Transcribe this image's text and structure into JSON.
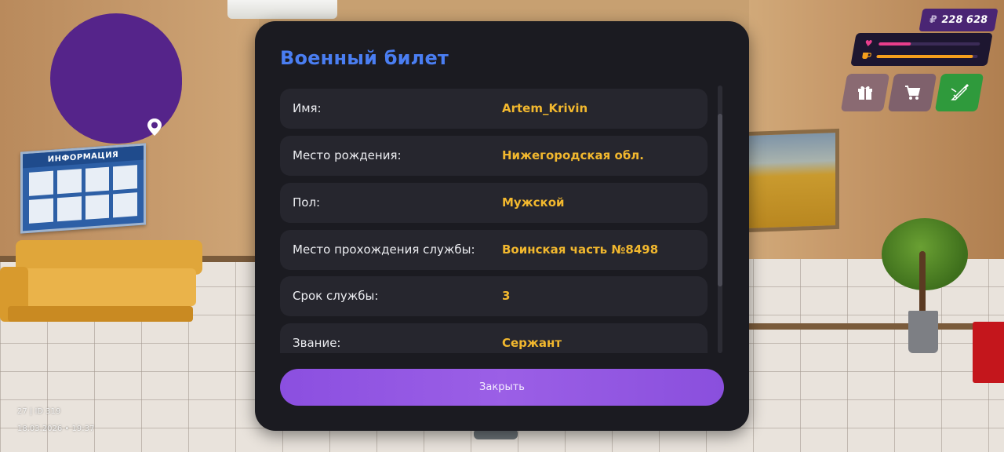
{
  "modal": {
    "title": "Военный билет",
    "rows": [
      {
        "label": "Имя:",
        "value": "Artem_Krivin"
      },
      {
        "label": "Место рождения:",
        "value": "Нижегородская обл."
      },
      {
        "label": "Пол:",
        "value": "Мужской"
      },
      {
        "label": "Место прохождения службы:",
        "value": "Воинская часть №8498"
      },
      {
        "label": "Срок службы:",
        "value": "3"
      },
      {
        "label": "Звание:",
        "value": "Сержант"
      }
    ],
    "close_label": "Закрыть",
    "title_color": "#4a7ef2",
    "value_color": "#f2b82e",
    "button_color": "#8b4fe0"
  },
  "hud": {
    "money_currency": "₽",
    "money_amount": "228 628",
    "health_level": 0.32,
    "hunger_level": 0.95,
    "health_color": "#e83e8c",
    "hunger_color": "#f59e1c",
    "buttons": [
      {
        "name": "gift",
        "icon": "gift-icon"
      },
      {
        "name": "cart",
        "icon": "cart-icon"
      },
      {
        "name": "weapon",
        "icon": "weapon-icon",
        "color": "#2f9a3c"
      }
    ]
  },
  "minimap": {
    "color": "#55248a",
    "pin_icon": "location-pin-icon"
  },
  "scene": {
    "board_title": "ИНФОРМАЦИЯ"
  },
  "watermark": {
    "line1": "27 | ID 319",
    "line2": "18.03.2026 • 19:37"
  }
}
